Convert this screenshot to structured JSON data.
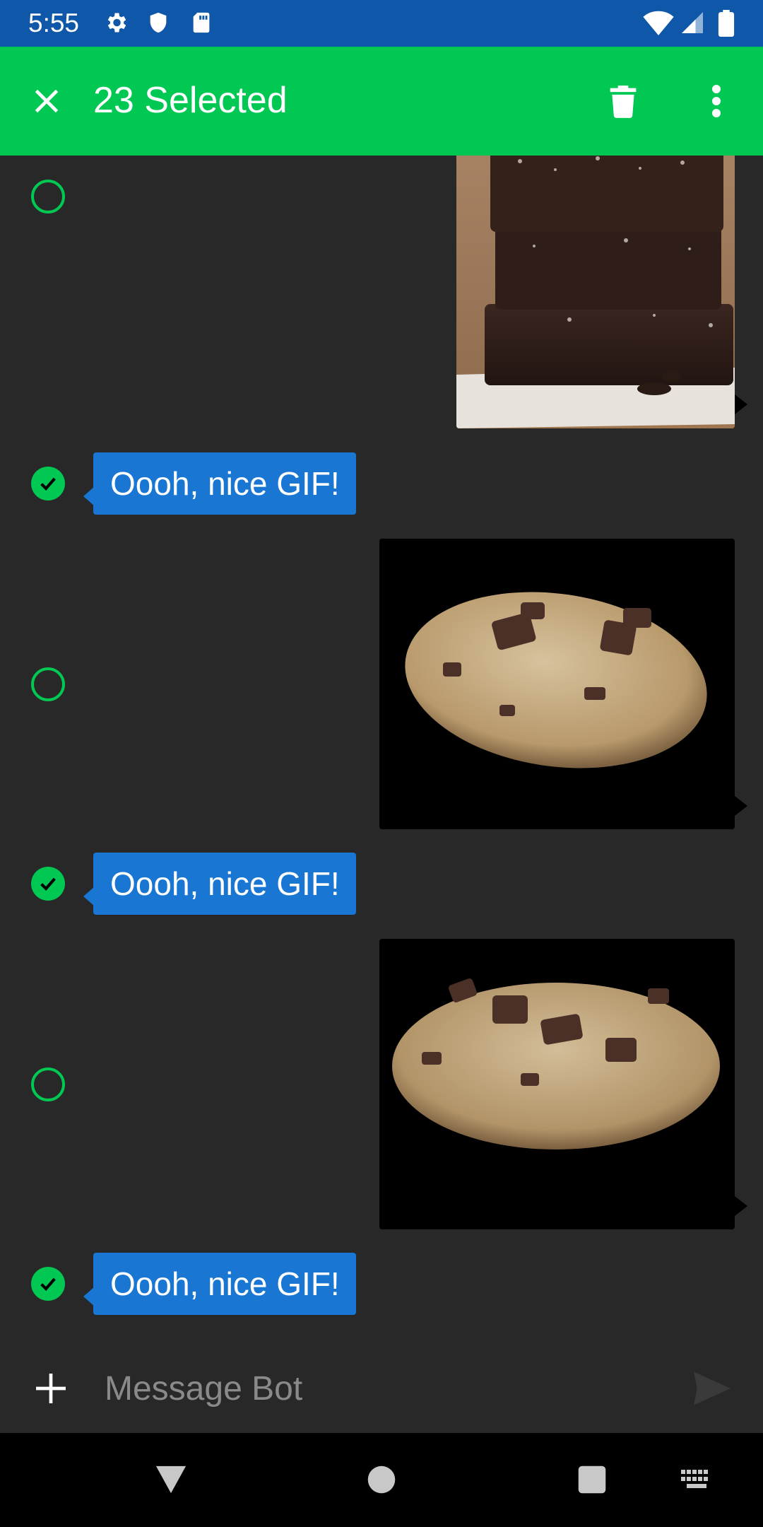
{
  "status_bar": {
    "time": "5:55",
    "left_icons": [
      "gear-icon",
      "shield-icon",
      "sd-card-icon"
    ],
    "right_icons": [
      "wifi-icon",
      "signal-icon",
      "battery-icon"
    ],
    "background": "#0f57a8"
  },
  "app_bar": {
    "title": "23 Selected",
    "close_icon": "close-icon",
    "delete_icon": "trash-icon",
    "more_icon": "more-vert-icon",
    "background": "#00c853"
  },
  "messages": [
    {
      "type": "image",
      "content": "brownie-stack",
      "selected": false
    },
    {
      "type": "text",
      "text": "Oooh, nice GIF!",
      "selected": true
    },
    {
      "type": "image",
      "content": "chocolate-chip-cookie",
      "selected": false
    },
    {
      "type": "text",
      "text": "Oooh, nice GIF!",
      "selected": true
    },
    {
      "type": "image",
      "content": "chocolate-chip-cookie",
      "selected": false
    },
    {
      "type": "text",
      "text": "Oooh, nice GIF!",
      "selected": true
    }
  ],
  "composer": {
    "placeholder": "Message Bot",
    "attach_icon": "plus-icon",
    "send_icon": "send-icon"
  },
  "nav_bar": {
    "icons": [
      "back-icon",
      "home-icon",
      "recents-icon",
      "keyboard-icon"
    ]
  },
  "colors": {
    "accent": "#00c853",
    "bubble": "#1976d2",
    "background": "#282828"
  }
}
